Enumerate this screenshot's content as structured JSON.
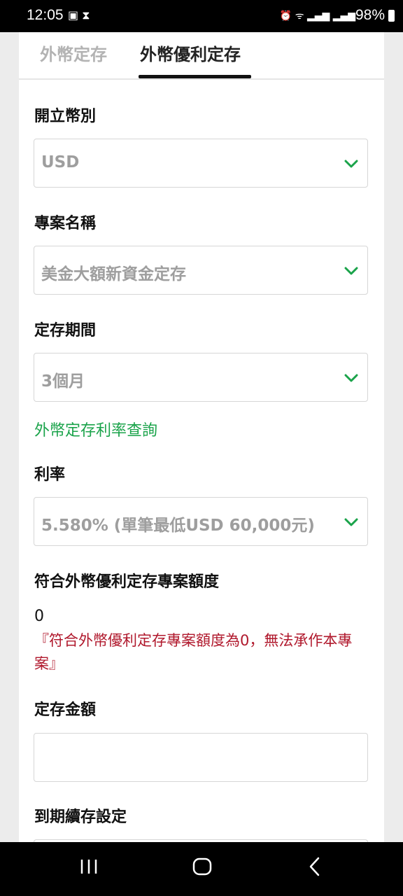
{
  "status": {
    "time": "12:05",
    "battery": "98%"
  },
  "tabs": [
    {
      "label": "外幣定存",
      "active": false
    },
    {
      "label": "外幣優利定存",
      "active": true
    }
  ],
  "form": {
    "currency": {
      "label": "開立幣別",
      "value": "USD"
    },
    "project": {
      "label": "專案名稱",
      "value": "美金大額新資金定存"
    },
    "term": {
      "label": "定存期間",
      "value": "3個月"
    },
    "rate_link": "外幣定存利率查詢",
    "rate": {
      "label": "利率",
      "value": "5.580% (單筆最低USD 60,000元)"
    },
    "quota": {
      "label": "符合外幣優利定存專案額度",
      "value": "0",
      "warning": "『符合外幣優利定存專案額度為0，無法承作本專案』"
    },
    "amount": {
      "label": "定存金額",
      "value": ""
    },
    "renewal": {
      "label": "到期續存設定"
    }
  },
  "colors": {
    "accent_green": "#1aa34a",
    "warning_red": "#b0182c"
  }
}
